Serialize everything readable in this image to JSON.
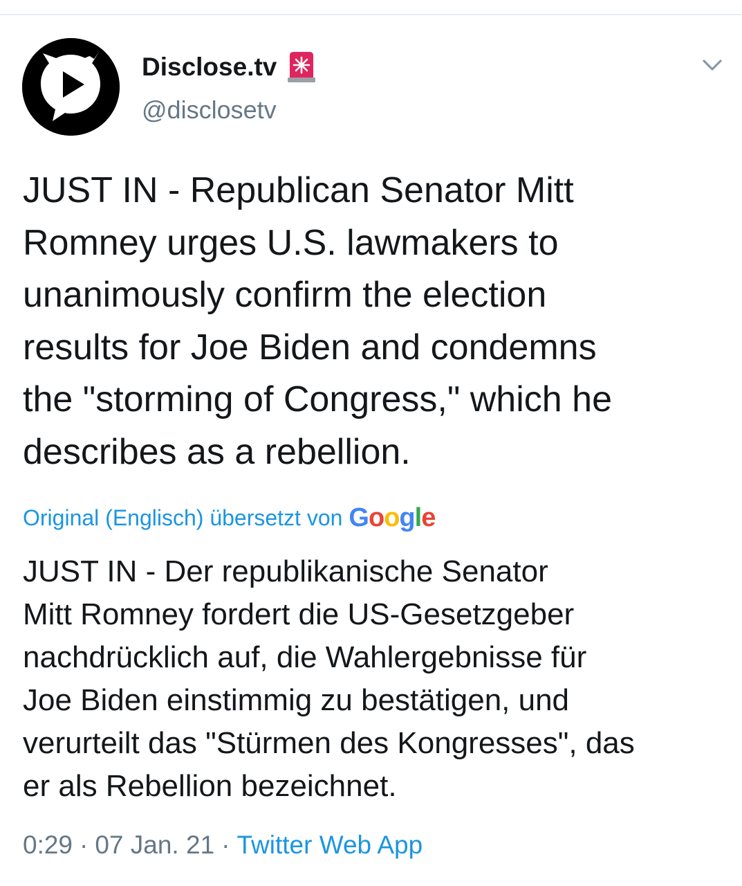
{
  "tweet": {
    "display_name": "Disclose.tv",
    "handle": "@disclosetv",
    "text": "JUST IN - Republican Senator Mitt\nRomney urges U.S. lawmakers to\nunanimously confirm the election\nresults for Joe Biden and condemns\nthe \"storming of Congress,\" which he\ndescribes as a rebellion.",
    "translation_label": "Original (Englisch) übersetzt von",
    "translation_provider": "Google",
    "translated_text": "JUST IN - Der republikanische Senator\nMitt Romney fordert die US-Gesetzgeber\nnachdrücklich auf, die Wahlergebnisse für\nJoe Biden einstimmig zu bestätigen, und\nverurteilt das \"Stürmen des Kongresses\", das\ner als Rebellion bezeichnet.",
    "time": "0:29",
    "date": "07 Jan. 21",
    "separator": "·",
    "source": "Twitter Web App"
  },
  "colors": {
    "text": "#14171a",
    "secondary": "#657786",
    "link": "#1b95e0",
    "siren": "#e0245e"
  },
  "icons": {
    "avatar": "play-speech-bubble-logo",
    "badge": "siren-icon",
    "menu": "chevron-down-icon"
  }
}
